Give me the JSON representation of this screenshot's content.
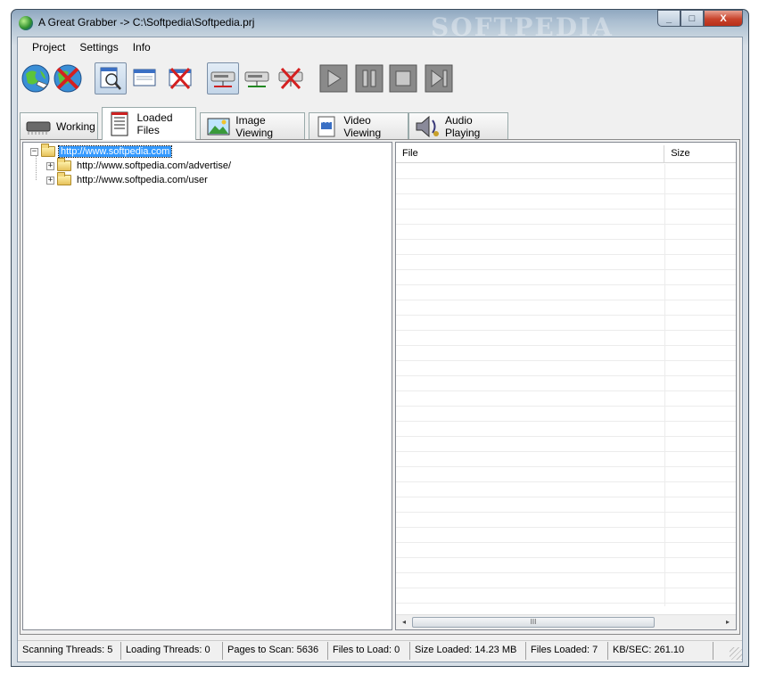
{
  "window": {
    "title": "A Great Grabber -> C:\\Softpedia\\Softpedia.prj",
    "watermark": "SOFTPEDIA",
    "controls": {
      "minimize": "_",
      "maximize": "□",
      "close": "X"
    }
  },
  "menu": {
    "items": [
      "Project",
      "Settings",
      "Info"
    ]
  },
  "toolbar": {
    "buttons": [
      {
        "icon": "globe-go-icon",
        "pressed": false
      },
      {
        "icon": "globe-stop-icon",
        "pressed": false
      },
      {
        "icon": "magnifier-page-icon",
        "pressed": true
      },
      {
        "icon": "window-icon",
        "pressed": false
      },
      {
        "icon": "window-close-icon",
        "pressed": false
      },
      {
        "icon": "network-icon",
        "pressed": true
      },
      {
        "icon": "network-add-icon",
        "pressed": false
      },
      {
        "icon": "network-remove-icon",
        "pressed": false
      },
      {
        "icon": "play-icon",
        "pressed": false
      },
      {
        "icon": "pause-icon",
        "pressed": false
      },
      {
        "icon": "stop-icon",
        "pressed": false
      },
      {
        "icon": "skip-icon",
        "pressed": false
      }
    ]
  },
  "tabs": [
    {
      "label": "Working",
      "icon": "chip-icon",
      "active": false
    },
    {
      "label": "Loaded Files",
      "icon": "document-icon",
      "active": true
    },
    {
      "label": "Image Viewing",
      "icon": "image-icon",
      "active": false
    },
    {
      "label": "Video Viewing",
      "icon": "film-icon",
      "active": false
    },
    {
      "label": "Audio Playing",
      "icon": "music-icon",
      "active": false
    }
  ],
  "tree": {
    "root": "http://www.softpedia.com",
    "root_expander": "−",
    "children": [
      {
        "label": "http://www.softpedia.com/advertise/",
        "expander": "+"
      },
      {
        "label": "http://www.softpedia.com/user",
        "expander": "+"
      }
    ]
  },
  "file_list": {
    "columns": [
      "File",
      "Size"
    ],
    "scroll_left": "◂",
    "scroll_right": "▸",
    "thumb_grip": "III"
  },
  "status": {
    "scanning_threads": "Scanning Threads: 5",
    "loading_threads": "Loading Threads: 0",
    "pages_to_scan": "Pages to Scan: 5636",
    "files_to_load": "Files to Load: 0",
    "size_loaded": "Size Loaded: 14.23 MB",
    "files_loaded": "Files Loaded: 7",
    "kb_sec": "KB/SEC: 261.10"
  }
}
